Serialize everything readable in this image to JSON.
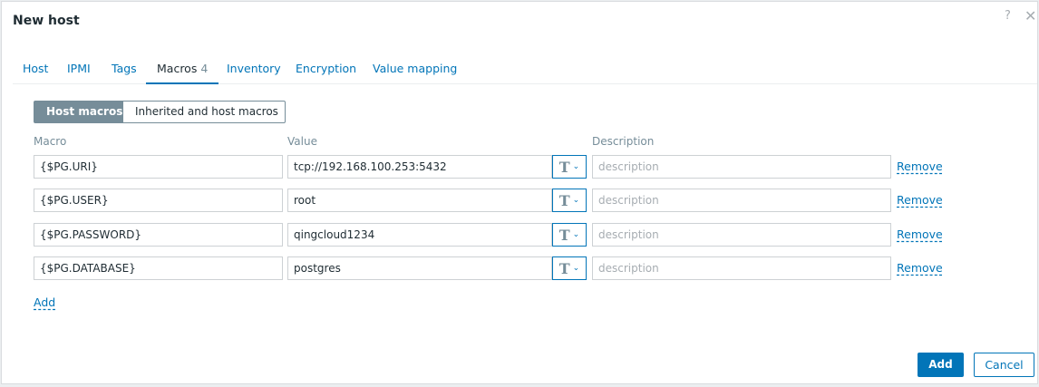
{
  "dialog": {
    "title": "New host",
    "help_glyph": "?",
    "close_glyph": "✕"
  },
  "tabs": [
    {
      "label": "Host"
    },
    {
      "label": "IPMI"
    },
    {
      "label": "Tags"
    },
    {
      "label": "Macros",
      "count": "4",
      "active": true
    },
    {
      "label": "Inventory"
    },
    {
      "label": "Encryption"
    },
    {
      "label": "Value mapping"
    }
  ],
  "macro_mode": {
    "active_label": "Host macros",
    "inactive_label": "Inherited and host macros"
  },
  "columns": {
    "macro": "Macro",
    "value": "Value",
    "description": "Description"
  },
  "macros": [
    {
      "macro": "{$PG.URI}",
      "value": "tcp://192.168.100.253:5432",
      "description_placeholder": "description",
      "type_glyph": "T",
      "remove_label": "Remove"
    },
    {
      "macro": "{$PG.USER}",
      "value": "root",
      "description_placeholder": "description",
      "type_glyph": "T",
      "remove_label": "Remove"
    },
    {
      "macro": "{$PG.PASSWORD}",
      "value": "qingcloud1234",
      "description_placeholder": "description",
      "type_glyph": "T",
      "remove_label": "Remove"
    },
    {
      "macro": "{$PG.DATABASE}",
      "value": "postgres",
      "description_placeholder": "description",
      "type_glyph": "T",
      "remove_label": "Remove"
    }
  ],
  "add_macro_label": "Add",
  "footer": {
    "add_label": "Add",
    "cancel_label": "Cancel"
  },
  "icons": {
    "help": "question-icon",
    "close": "close-icon",
    "type_dropdown": "chevron-down-icon"
  },
  "colors": {
    "accent": "#0275b8",
    "segment_active": "#768d99",
    "text": "#1f2c33",
    "muted": "#768d99"
  }
}
